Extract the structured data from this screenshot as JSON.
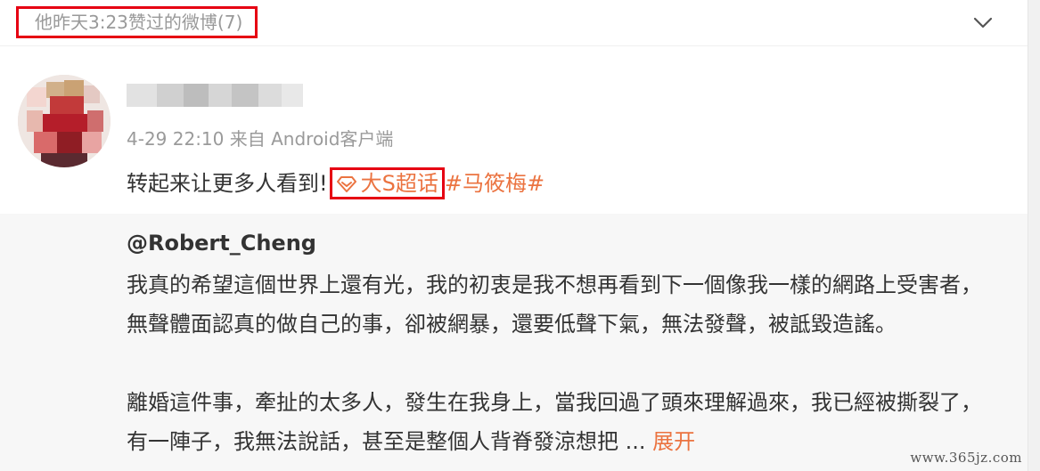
{
  "group_header": {
    "title": "他昨天3:23赞过的微博(7)",
    "toggle_icon": "chevron-down-icon"
  },
  "post": {
    "username": "*mpfistuner",
    "username_obscured": true,
    "meta": {
      "time": "4-29 22:10",
      "source_prefix": "来自",
      "source": "Android客户端"
    },
    "content": {
      "text": "转起来让更多人看到!",
      "super_topic_icon": "diamond-supertopic-icon",
      "super_topic": "大S超话",
      "hashtag": "#马筱梅#"
    },
    "retweet": {
      "author": "@Robert_Cheng",
      "paragraph1": "我真的希望這個世界上還有光，我的初衷是我不想再看到下一個像我一樣的網路上受害者，無聲體面認真的做自己的事，卻被網暴，還要低聲下氣，無法發聲，被詆毀造謠。",
      "paragraph2": "離婚這件事，牽扯的太多人，發生在我身上，當我回過了頭來理解過來，我已經被撕裂了，有一陣子，我無法說話，甚至是整個人背脊發涼想把",
      "ellipsis": " ... ",
      "expand_label": "展开"
    }
  },
  "watermark": "www.365jz.com",
  "colors": {
    "highlight_box": "#e60012",
    "link_orange": "#eb7340",
    "muted_text": "#999999",
    "retweet_bg": "#f7f7f7"
  }
}
